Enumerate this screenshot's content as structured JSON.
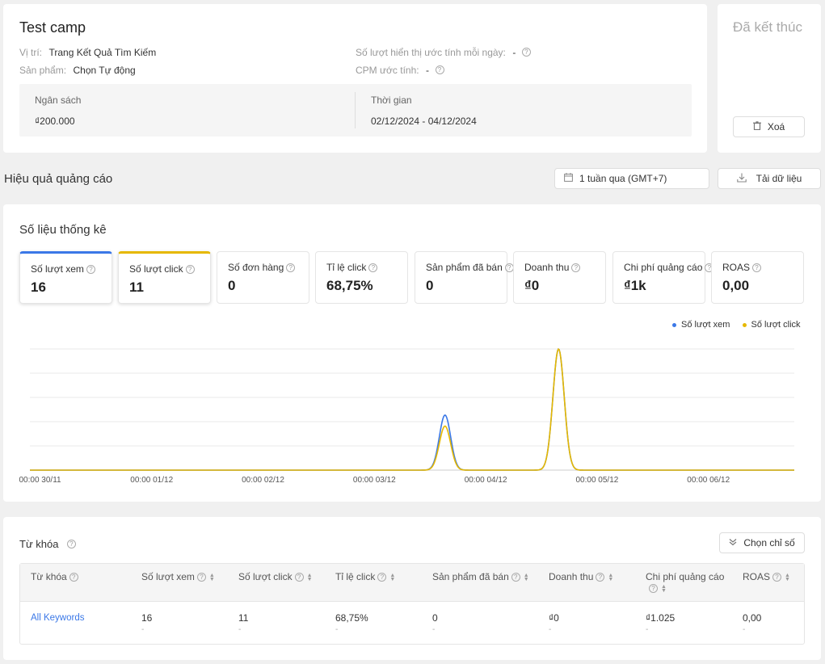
{
  "campaign": {
    "name": "Test camp",
    "status": "Đã kết thúc",
    "position_label": "Vị trí:",
    "position_value": "Trang Kết Quả Tìm Kiếm",
    "product_label": "Sản phẩm:",
    "product_value": "Chọn Tự động",
    "est_impressions_label": "Số lượt hiển thị ước tính mỗi ngày:",
    "est_impressions_value": "-",
    "cpm_label": "CPM ước tính:",
    "cpm_value": "-",
    "budget_label": "Ngân sách",
    "budget_value": "₫200.000",
    "time_label": "Thời gian",
    "time_value": "02/12/2024 - 04/12/2024",
    "delete_label": "Xoá"
  },
  "performance": {
    "title": "Hiệu quả quảng cáo",
    "date_range": "1 tuần qua (GMT+7)",
    "download_label": "Tải dữ liệu"
  },
  "stats": {
    "title": "Số liệu thống kê",
    "metrics": [
      {
        "label": "Số lượt xem",
        "value": "16",
        "selected_color": "#3b78e7"
      },
      {
        "label": "Số lượt click",
        "value": "11",
        "selected_color": "#e6b800"
      },
      {
        "label": "Số đơn hàng",
        "value": "0"
      },
      {
        "label": "Tỉ lệ click",
        "value": "68,75%"
      },
      {
        "label": "Sản phẩm đã bán",
        "value": "0"
      },
      {
        "label": "Doanh thu",
        "value": "₫0"
      },
      {
        "label": "Chi phí quảng cáo",
        "value": "₫1k"
      },
      {
        "label": "ROAS",
        "value": "0,00"
      }
    ]
  },
  "chart_data": {
    "type": "line",
    "x": [
      "00:00 30/11",
      "00:00 01/12",
      "00:00 02/12",
      "00:00 03/12",
      "00:00 04/12",
      "00:00 05/12",
      "00:00 06/12"
    ],
    "series": [
      {
        "name": "Số lượt xem",
        "color": "#3b78e7",
        "peaks": [
          {
            "day": 3.63,
            "value": 5
          },
          {
            "day": 4.65,
            "value": 11
          }
        ]
      },
      {
        "name": "Số lượt click",
        "color": "#e6b800",
        "peaks": [
          {
            "day": 3.63,
            "value": 4
          },
          {
            "day": 4.65,
            "value": 11
          }
        ]
      }
    ],
    "ylim": [
      0,
      11
    ],
    "grid": true,
    "legend": "top-right"
  },
  "keywords": {
    "title": "Từ khóa",
    "choose_metrics_label": "Chọn chỉ số",
    "columns": [
      "Từ khóa",
      "Số lượt xem",
      "Số lượt click",
      "Tỉ lệ click",
      "Sản phẩm đã bán",
      "Doanh thu",
      "Chi phí quảng cáo",
      "ROAS"
    ],
    "row": {
      "keyword": "All Keywords",
      "views": "16",
      "clicks": "11",
      "ctr": "68,75%",
      "sold": "0",
      "revenue": "₫0",
      "cost": "₫1.025",
      "roas": "0,00",
      "dash": "-"
    }
  }
}
